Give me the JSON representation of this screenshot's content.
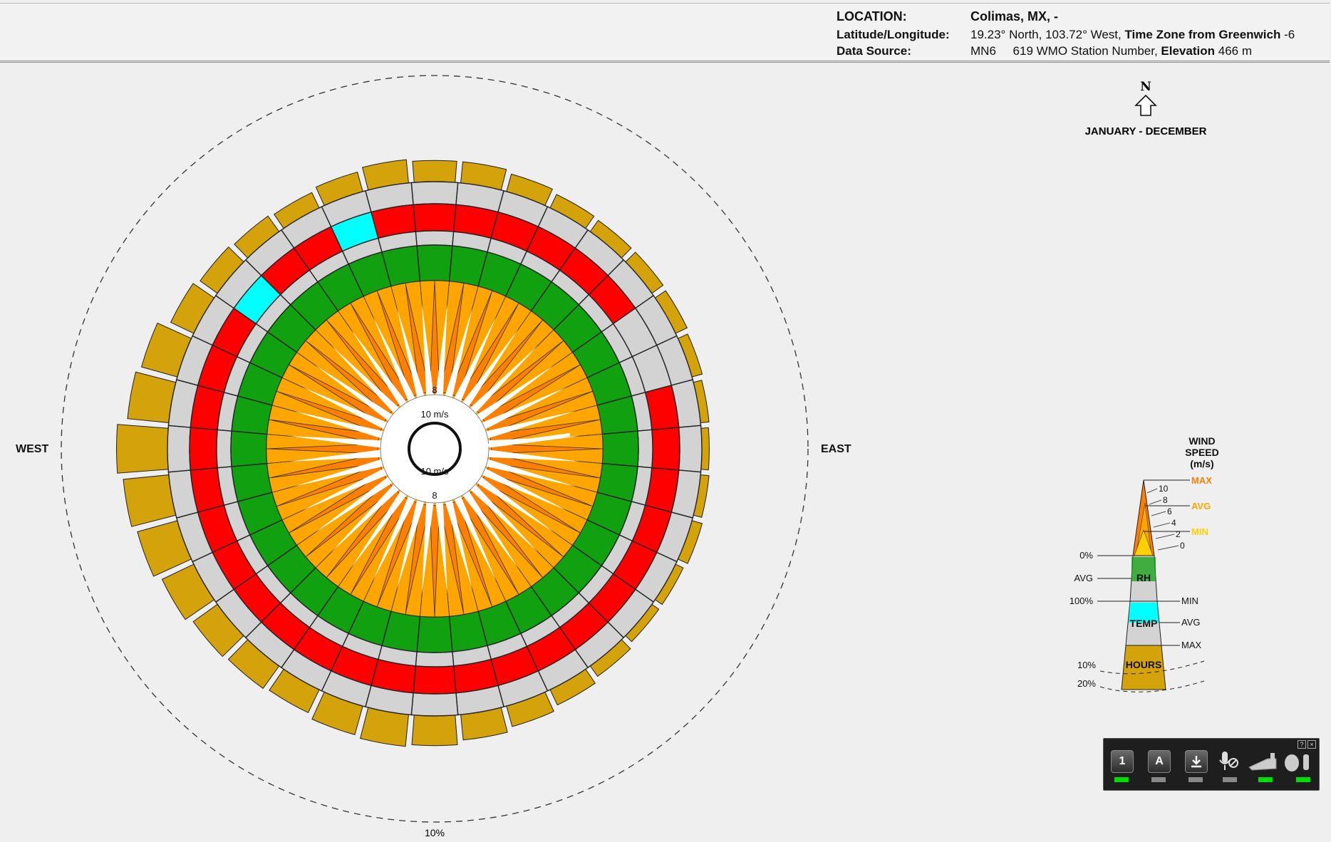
{
  "header": {
    "location_label": "LOCATION:",
    "location_value": "Colimas, MX, -",
    "latlon_label": "Latitude/Longitude:",
    "latlon_value": "19.23° North, 103.72° West,",
    "timezone_label": "Time Zone from Greenwich",
    "timezone_value": "-6",
    "source_label": "Data Source:",
    "source_code": "MN6",
    "wmo_value": "619 WMO Station Number,",
    "elevation_label": "Elevation",
    "elevation_value": "466 m"
  },
  "compass": {
    "west": "WEST",
    "east": "EAST",
    "north": "N"
  },
  "period": "JANUARY - DECEMBER",
  "ring_label": "10%",
  "center_labels": {
    "top_speed": "10 m/s",
    "top_tick": "8",
    "bottom_speed": "10 m/s",
    "bottom_tick": "8"
  },
  "legend": {
    "title1": "WIND",
    "title2": "SPEED",
    "title3": "(m/s)",
    "max": "MAX",
    "avg": "AVG",
    "min": "MIN",
    "ticks": [
      "10",
      "8",
      "6",
      "4",
      "2",
      "0"
    ],
    "rh_left": [
      "0%",
      "AVG",
      "100%"
    ],
    "rh": "RH",
    "temp": "TEMP",
    "temp_right": [
      "MIN",
      "AVG",
      "MAX"
    ],
    "hours": "HOURS",
    "hours_pct": [
      "10%",
      "20%"
    ]
  },
  "colors": {
    "hours": "#d4a20a",
    "grey": "#d3d3d3",
    "hot": "#ff0000",
    "cool": "#00ffff",
    "rh": "#10a010",
    "max_wind": "#ff7f00",
    "avg_wind": "#ffa500",
    "min_wind": "#ffd000"
  },
  "toolbar": {
    "buttons": [
      "1",
      "A",
      "download-icon",
      "mic-muted-icon",
      "keyboard-icon",
      "mouse-icon"
    ],
    "help": "?",
    "close": "×"
  },
  "chart_data": {
    "type": "wind-wheel",
    "directions": 36,
    "direction_deg": [
      0,
      10,
      20,
      30,
      40,
      50,
      60,
      70,
      80,
      90,
      100,
      110,
      120,
      130,
      140,
      150,
      160,
      170,
      180,
      190,
      200,
      210,
      220,
      230,
      240,
      250,
      260,
      270,
      280,
      290,
      300,
      310,
      320,
      330,
      340,
      350
    ],
    "hours_pct": [
      2.0,
      2.0,
      1.7,
      1.4,
      1.3,
      1.3,
      1.2,
      1.0,
      0.8,
      0.7,
      0.8,
      1.0,
      0.8,
      0.8,
      1.2,
      1.6,
      2.0,
      2.4,
      2.8,
      3.0,
      2.8,
      2.4,
      2.6,
      2.8,
      3.3,
      3.9,
      4.3,
      4.8,
      3.9,
      3.5,
      2.4,
      2.0,
      1.8,
      1.6,
      1.9,
      2.2
    ],
    "temp_color": [
      "hot",
      "hot",
      "hot",
      "hot",
      "hot",
      "hot",
      "grey",
      "grey",
      "hot",
      "hot",
      "hot",
      "hot",
      "hot",
      "hot",
      "hot",
      "hot",
      "hot",
      "hot",
      "hot",
      "hot",
      "hot",
      "hot",
      "hot",
      "hot",
      "hot",
      "hot",
      "hot",
      "hot",
      "hot",
      "hot",
      "hot",
      "cool",
      "hot",
      "hot",
      "cool",
      "hot"
    ],
    "rh_avg": "green",
    "wind_max_ms": 10,
    "wind_avg_ms": 8,
    "ring_scale_pct": 10
  }
}
